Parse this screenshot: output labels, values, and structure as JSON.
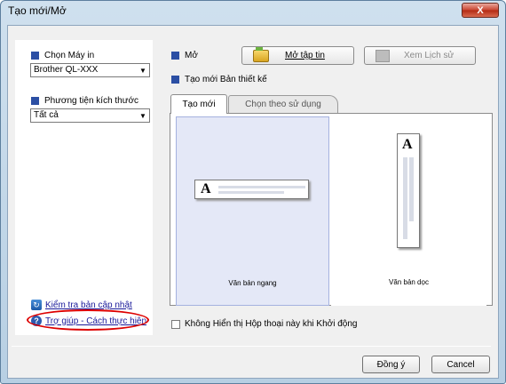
{
  "window": {
    "title": "Tạo mới/Mở",
    "close_label": "X"
  },
  "left": {
    "printer_label": "Chọn Máy in",
    "printer_value": "Brother QL-XXX",
    "media_label": "Phương tiện kích thước",
    "media_value": "Tất cả",
    "update_link": "Kiểm tra bản cập nhật",
    "help_link": "Trợ giúp - Cách thực hiện"
  },
  "open": {
    "label": "Mở",
    "open_file_button": "Mở tập tin",
    "history_button": "Xem Lịch sử"
  },
  "create": {
    "label": "Tạo mới Bản thiết kế",
    "tabs": [
      {
        "label": "Tạo mới",
        "active": true
      },
      {
        "label": "Chọn theo sử dụng",
        "active": false
      }
    ],
    "cards": [
      {
        "label": "Văn bản ngang",
        "selected": true
      },
      {
        "label": "Văn bản dọc",
        "selected": false
      }
    ],
    "doc_glyph": "A"
  },
  "startup_checkbox": {
    "label": "Không Hiển thị Hộp thoại này khi Khởi động",
    "checked": false
  },
  "footer": {
    "ok_button": "Đồng ý",
    "cancel_button": "Cancel"
  },
  "colors": {
    "section_marker": "#2c4fa4",
    "selected_card": "#e4e8f7",
    "annotation_circle": "#dd0000"
  },
  "icons": [
    "close-icon",
    "dropdown-arrow-icon",
    "folder-icon",
    "history-icon",
    "update-icon",
    "help-icon"
  ]
}
